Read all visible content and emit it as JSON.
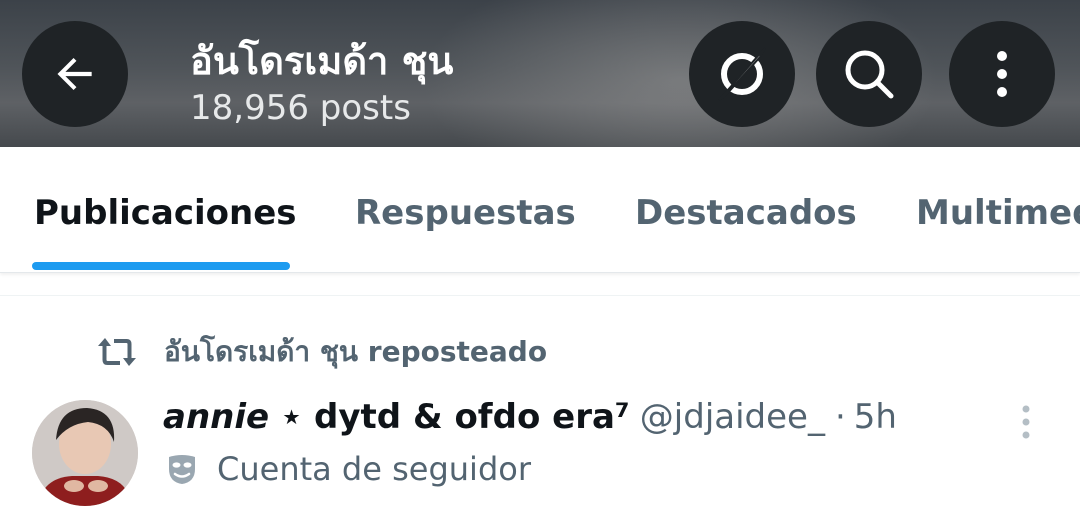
{
  "header": {
    "title": "อันโดรเมด้า ชุน",
    "post_count": "18,956 posts"
  },
  "icons": {
    "back": "arrow-left-icon",
    "grok": "grok-icon",
    "search": "search-icon",
    "more": "more-vertical-icon",
    "repost": "repost-icon",
    "label": "theater-mask-icon"
  },
  "tabs": [
    {
      "label": "Publicaciones",
      "active": true
    },
    {
      "label": "Respuestas",
      "active": false
    },
    {
      "label": "Destacados",
      "active": false
    },
    {
      "label": "Multimed",
      "active": false
    }
  ],
  "post": {
    "repost_label": "อันโดรเมด้า ชุน reposteado",
    "display_name_italic": "annie",
    "display_name_rest": " ⋆ dytd & ofdo era⁷",
    "handle": "@jdjaidee_",
    "separator": "·",
    "time": "5h",
    "account_label": "Cuenta de seguidor"
  },
  "colors": {
    "accent": "#1d9bf0",
    "text_primary": "#0f1419",
    "text_secondary": "#536471",
    "button_bg": "#1f2326"
  }
}
